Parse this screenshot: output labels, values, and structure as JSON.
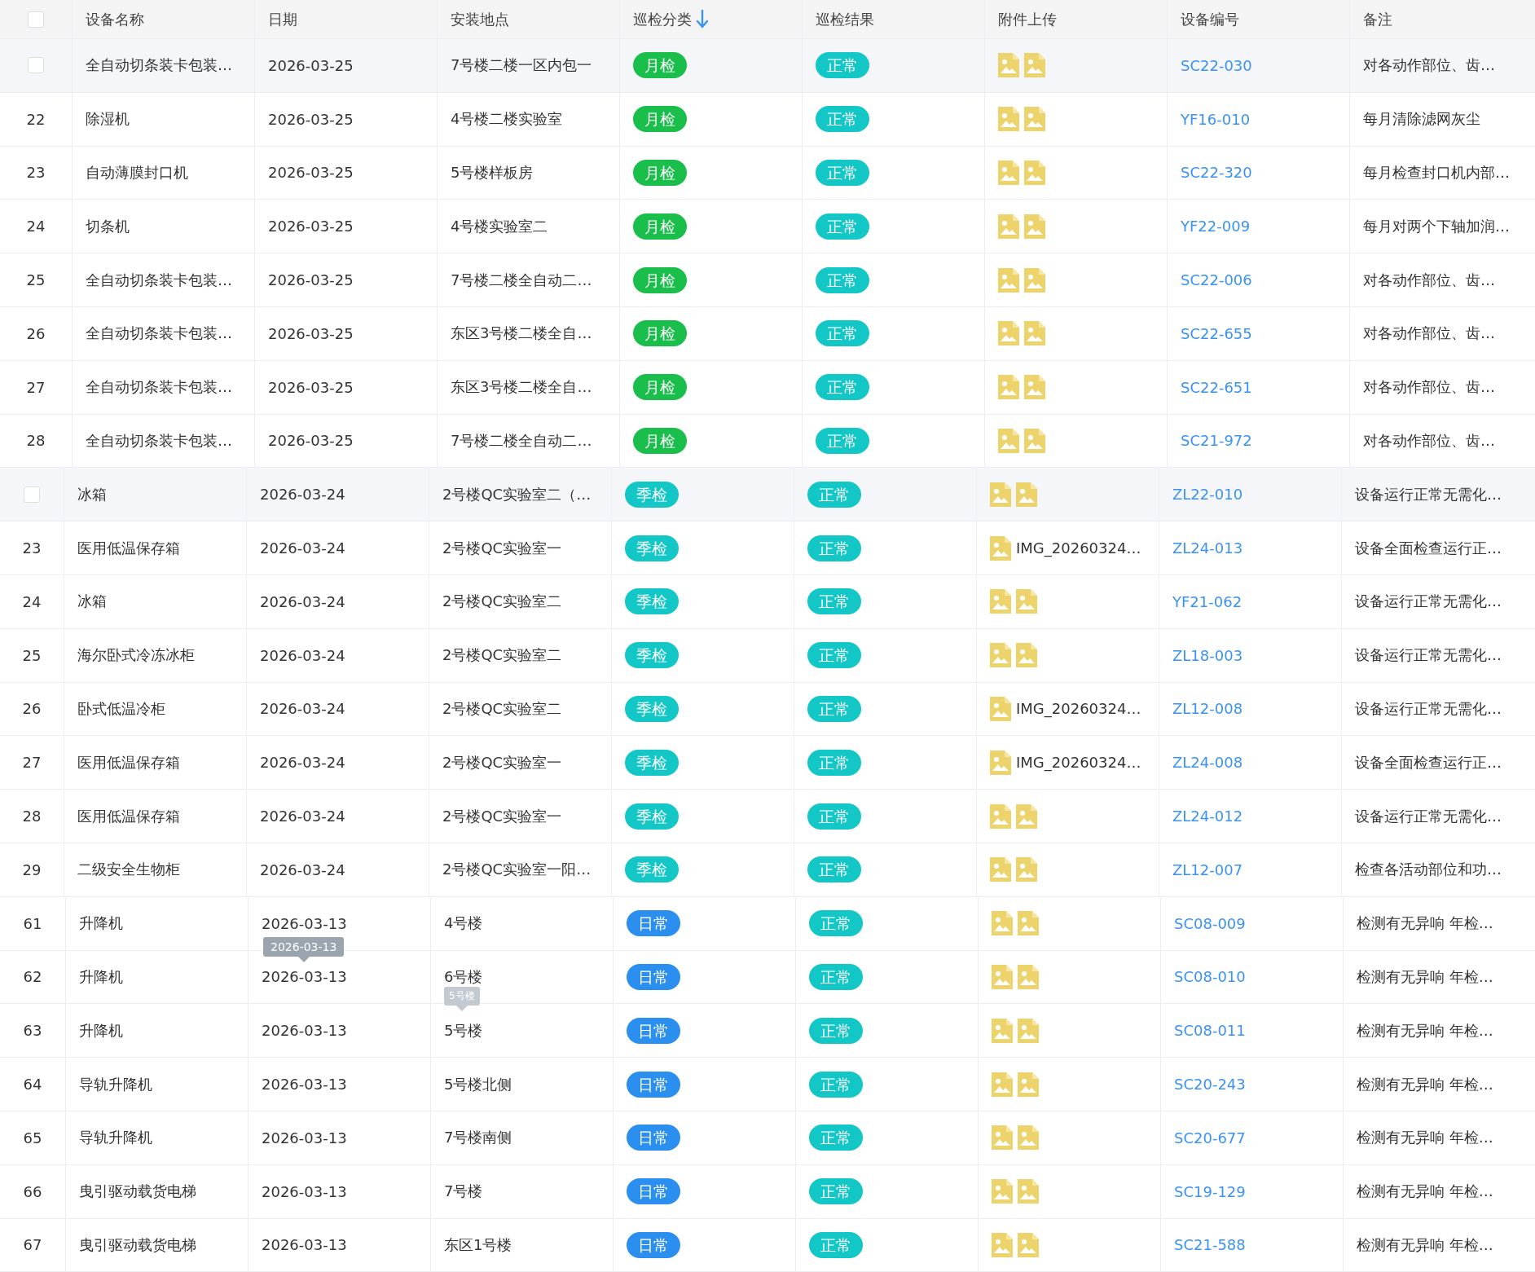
{
  "header": {
    "checked": false,
    "columns": [
      {
        "label": "设备名称"
      },
      {
        "label": "日期"
      },
      {
        "label": "安装地点"
      },
      {
        "label": "巡检分类",
        "sorted_descending": true
      },
      {
        "label": "巡检结果"
      },
      {
        "label": "附件上传"
      },
      {
        "label": "设备编号"
      },
      {
        "label": "备注"
      }
    ]
  },
  "sections": [
    {
      "rows": [
        {
          "hovered": true,
          "checked": false,
          "name": "全自动切条装卡包装…",
          "date": "2026-03-25",
          "location": "7号楼二楼一区内包一",
          "type": {
            "label": "月检",
            "color": "#19be4b"
          },
          "result": "正常",
          "attachments": [
            {
              "kind": "image"
            },
            {
              "kind": "image"
            }
          ],
          "code": "SC22-030",
          "note": "对各动作部位、齿…"
        },
        {
          "hovered": false,
          "index": "22",
          "name": "除湿机",
          "date": "2026-03-25",
          "location": "4号楼二楼实验室",
          "type": {
            "label": "月检",
            "color": "#19be4b"
          },
          "result": "正常",
          "attachments": [
            {
              "kind": "image"
            },
            {
              "kind": "image"
            }
          ],
          "code": "YF16-010",
          "note": "每月清除滤网灰尘"
        },
        {
          "hovered": false,
          "index": "23",
          "name": "自动薄膜封口机",
          "date": "2026-03-25",
          "location": "5号楼样板房",
          "type": {
            "label": "月检",
            "color": "#19be4b"
          },
          "result": "正常",
          "attachments": [
            {
              "kind": "image"
            },
            {
              "kind": "image"
            }
          ],
          "code": "SC22-320",
          "note": "每月检查封口机内部…"
        },
        {
          "hovered": false,
          "index": "24",
          "name": "切条机",
          "date": "2026-03-25",
          "location": "4号楼实验室二",
          "type": {
            "label": "月检",
            "color": "#19be4b"
          },
          "result": "正常",
          "attachments": [
            {
              "kind": "image"
            },
            {
              "kind": "image"
            }
          ],
          "code": "YF22-009",
          "note": "每月对两个下轴加润…"
        },
        {
          "hovered": false,
          "index": "25",
          "name": "全自动切条装卡包装…",
          "date": "2026-03-25",
          "location": "7号楼二楼全自动二…",
          "type": {
            "label": "月检",
            "color": "#19be4b"
          },
          "result": "正常",
          "attachments": [
            {
              "kind": "image"
            },
            {
              "kind": "image"
            }
          ],
          "code": "SC22-006",
          "note": "对各动作部位、齿…"
        },
        {
          "hovered": false,
          "index": "26",
          "name": "全自动切条装卡包装…",
          "date": "2026-03-25",
          "location": "东区3号楼二楼全自…",
          "type": {
            "label": "月检",
            "color": "#19be4b"
          },
          "result": "正常",
          "attachments": [
            {
              "kind": "image"
            },
            {
              "kind": "image"
            }
          ],
          "code": "SC22-655",
          "note": "对各动作部位、齿…"
        },
        {
          "hovered": false,
          "index": "27",
          "name": "全自动切条装卡包装…",
          "date": "2026-03-25",
          "location": "东区3号楼二楼全自…",
          "type": {
            "label": "月检",
            "color": "#19be4b"
          },
          "result": "正常",
          "attachments": [
            {
              "kind": "image"
            },
            {
              "kind": "image"
            }
          ],
          "code": "SC22-651",
          "note": "对各动作部位、齿…"
        },
        {
          "hovered": false,
          "index": "28",
          "name": "全自动切条装卡包装…",
          "date": "2026-03-25",
          "location": "7号楼二楼全自动二…",
          "type": {
            "label": "月检",
            "color": "#19be4b"
          },
          "result": "正常",
          "attachments": [
            {
              "kind": "image"
            },
            {
              "kind": "image"
            }
          ],
          "code": "SC21-972",
          "note": "对各动作部位、齿…"
        }
      ]
    },
    {
      "rows": [
        {
          "hovered": true,
          "checked": false,
          "name": "冰箱",
          "date": "2026-03-24",
          "location": "2号楼QC实验室二（…",
          "type": {
            "label": "季检",
            "color": "#14c7c7"
          },
          "result": "正常",
          "attachments": [
            {
              "kind": "image"
            },
            {
              "kind": "image"
            }
          ],
          "code": "ZL22-010",
          "note": "设备运行正常无需化…"
        },
        {
          "hovered": false,
          "index": "23",
          "name": "医用低温保存箱",
          "date": "2026-03-24",
          "location": "2号楼QC实验室一",
          "type": {
            "label": "季检",
            "color": "#14c7c7"
          },
          "result": "正常",
          "attachments": [
            {
              "kind": "file",
              "name": "IMG_20260324…"
            }
          ],
          "code": "ZL24-013",
          "note": "设备全面检查运行正…"
        },
        {
          "hovered": false,
          "index": "24",
          "name": "冰箱",
          "date": "2026-03-24",
          "location": "2号楼QC实验室二",
          "type": {
            "label": "季检",
            "color": "#14c7c7"
          },
          "result": "正常",
          "attachments": [
            {
              "kind": "image"
            },
            {
              "kind": "image"
            }
          ],
          "code": "YF21-062",
          "note": "设备运行正常无需化…"
        },
        {
          "hovered": false,
          "index": "25",
          "name": "海尔卧式冷冻冰柜",
          "date": "2026-03-24",
          "location": "2号楼QC实验室二",
          "type": {
            "label": "季检",
            "color": "#14c7c7"
          },
          "result": "正常",
          "attachments": [
            {
              "kind": "image"
            },
            {
              "kind": "image"
            }
          ],
          "code": "ZL18-003",
          "note": "设备运行正常无需化…"
        },
        {
          "hovered": false,
          "index": "26",
          "name": "卧式低温冷柜",
          "date": "2026-03-24",
          "location": "2号楼QC实验室二",
          "type": {
            "label": "季检",
            "color": "#14c7c7"
          },
          "result": "正常",
          "attachments": [
            {
              "kind": "file",
              "name": "IMG_20260324…"
            }
          ],
          "code": "ZL12-008",
          "note": "设备运行正常无需化…"
        },
        {
          "hovered": false,
          "index": "27",
          "name": "医用低温保存箱",
          "date": "2026-03-24",
          "location": "2号楼QC实验室一",
          "type": {
            "label": "季检",
            "color": "#14c7c7"
          },
          "result": "正常",
          "attachments": [
            {
              "kind": "file",
              "name": "IMG_20260324…"
            }
          ],
          "code": "ZL24-008",
          "note": "设备全面检查运行正…"
        },
        {
          "hovered": false,
          "index": "28",
          "name": "医用低温保存箱",
          "date": "2026-03-24",
          "location": "2号楼QC实验室一",
          "type": {
            "label": "季检",
            "color": "#14c7c7"
          },
          "result": "正常",
          "attachments": [
            {
              "kind": "image"
            },
            {
              "kind": "image"
            }
          ],
          "code": "ZL24-012",
          "note": "设备运行正常无需化…"
        },
        {
          "hovered": false,
          "index": "29",
          "name": "二级安全生物柜",
          "date": "2026-03-24",
          "location": "2号楼QC实验室一阳…",
          "type": {
            "label": "季检",
            "color": "#14c7c7"
          },
          "result": "正常",
          "attachments": [
            {
              "kind": "image"
            },
            {
              "kind": "image"
            }
          ],
          "code": "ZL12-007",
          "note": "检查各活动部位和功…"
        }
      ]
    },
    {
      "rows": [
        {
          "hovered": false,
          "index": "61",
          "name": "升降机",
          "date": "2026-03-13",
          "location": "4号楼",
          "type": {
            "label": "日常",
            "color": "#2b8ff0"
          },
          "result": "正常",
          "attachments": [
            {
              "kind": "image"
            },
            {
              "kind": "image"
            }
          ],
          "code": "SC08-009",
          "note": "检测有无异响 年检…"
        },
        {
          "hovered": false,
          "index": "62",
          "name": "升降机",
          "date": "2026-03-13",
          "date_tooltip": {
            "text": "2026-03-13",
            "faded": false
          },
          "location": "6号楼",
          "type": {
            "label": "日常",
            "color": "#2b8ff0"
          },
          "result": "正常",
          "attachments": [
            {
              "kind": "image"
            },
            {
              "kind": "image"
            }
          ],
          "code": "SC08-010",
          "note": "检测有无异响 年检…"
        },
        {
          "hovered": false,
          "index": "63",
          "name": "升降机",
          "date": "2026-03-13",
          "location": "5号楼",
          "location_tooltip": {
            "text": "5号楼",
            "faded": true
          },
          "type": {
            "label": "日常",
            "color": "#2b8ff0"
          },
          "result": "正常",
          "attachments": [
            {
              "kind": "image"
            },
            {
              "kind": "image"
            }
          ],
          "code": "SC08-011",
          "note": "检测有无异响 年检…"
        },
        {
          "hovered": false,
          "index": "64",
          "name": "导轨升降机",
          "date": "2026-03-13",
          "location": "5号楼北侧",
          "type": {
            "label": "日常",
            "color": "#2b8ff0"
          },
          "result": "正常",
          "attachments": [
            {
              "kind": "image"
            },
            {
              "kind": "image"
            }
          ],
          "code": "SC20-243",
          "note": "检测有无异响 年检…"
        },
        {
          "hovered": false,
          "index": "65",
          "name": "导轨升降机",
          "date": "2026-03-13",
          "location": "7号楼南侧",
          "type": {
            "label": "日常",
            "color": "#2b8ff0"
          },
          "result": "正常",
          "attachments": [
            {
              "kind": "image"
            },
            {
              "kind": "image"
            }
          ],
          "code": "SC20-677",
          "note": "检测有无异响 年检…"
        },
        {
          "hovered": false,
          "index": "66",
          "name": "曳引驱动载货电梯",
          "date": "2026-03-13",
          "location": "7号楼",
          "type": {
            "label": "日常",
            "color": "#2b8ff0"
          },
          "result": "正常",
          "attachments": [
            {
              "kind": "image"
            },
            {
              "kind": "image"
            }
          ],
          "code": "SC19-129",
          "note": "检测有无异响 年检…"
        },
        {
          "hovered": false,
          "index": "67",
          "name": "曳引驱动载货电梯",
          "date": "2026-03-13",
          "location": "东区1号楼",
          "type": {
            "label": "日常",
            "color": "#2b8ff0"
          },
          "result": "正常",
          "attachments": [
            {
              "kind": "image"
            },
            {
              "kind": "image"
            }
          ],
          "code": "SC21-588",
          "note": "检测有无异响 年检…"
        }
      ]
    }
  ]
}
